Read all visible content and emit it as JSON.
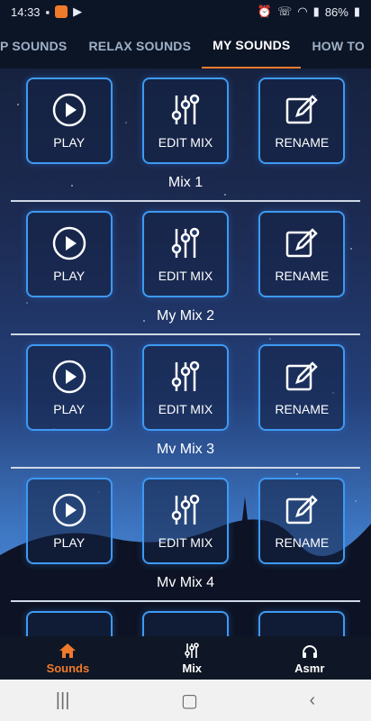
{
  "status_bar": {
    "time": "14:33",
    "battery": "86%"
  },
  "tabs": [
    {
      "label": "P SOUNDS",
      "active": false
    },
    {
      "label": "RELAX SOUNDS",
      "active": false
    },
    {
      "label": "MY SOUNDS",
      "active": true
    },
    {
      "label": "HOW TO",
      "active": false
    }
  ],
  "mix_rows": [
    {
      "name": "Mix 1"
    },
    {
      "name": "My Mix 2"
    },
    {
      "name": "Mv Mix 3"
    },
    {
      "name": "Mv Mix 4"
    }
  ],
  "buttons": {
    "play": "PLAY",
    "edit": "EDIT MIX",
    "rename": "RENAME"
  },
  "bottom_nav": [
    {
      "label": "Sounds",
      "icon": "home-icon",
      "active": true
    },
    {
      "label": "Mix",
      "icon": "sliders-icon",
      "active": false
    },
    {
      "label": "Asmr",
      "icon": "headphones-icon",
      "active": false
    }
  ],
  "colors": {
    "accent": "#f07a2b",
    "button_border": "#3e9af2"
  }
}
